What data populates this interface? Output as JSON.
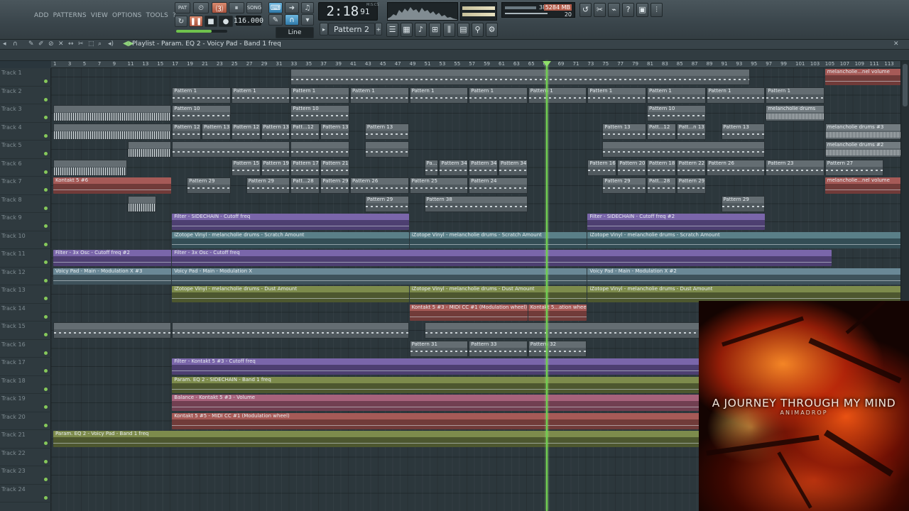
{
  "menu": [
    "ADD",
    "PATTERNS",
    "VIEW",
    "OPTIONS",
    "TOOLS",
    "?"
  ],
  "transport": {
    "pat_label": "PAT",
    "song_label": "SONG",
    "tempo": "116.000",
    "time_main": "2:18",
    "time_sub": "91",
    "time_unit": "M:S:CS",
    "snap": "Line",
    "pattern": "Pattern 2"
  },
  "cpu": {
    "value": "38",
    "memory": "5284 MB",
    "polyphony": "20"
  },
  "playlist": {
    "title": "Playlist - Param. EQ 2 - Voicy Pad - Band 1 freq"
  },
  "ruler": [
    "1",
    "3",
    "5",
    "7",
    "9",
    "11",
    "13",
    "15",
    "17",
    "19",
    "21",
    "23",
    "25",
    "27",
    "29",
    "31",
    "33",
    "35",
    "37",
    "39",
    "41",
    "43",
    "45",
    "47",
    "49",
    "51",
    "53",
    "55",
    "57",
    "59",
    "61",
    "63",
    "65",
    "67",
    "69",
    "71",
    "73",
    "75",
    "77",
    "79",
    "81",
    "83",
    "85",
    "87",
    "89",
    "91",
    "93",
    "95",
    "97",
    "99",
    "101",
    "103",
    "105",
    "107",
    "109",
    "111",
    "113"
  ],
  "tracks": [
    "Track 1",
    "Track 2",
    "Track 3",
    "Track 4",
    "Track 5",
    "Track 6",
    "Track 7",
    "Track 8",
    "Track 9",
    "Track 10",
    "Track 11",
    "Track 12",
    "Track 13",
    "Track 14",
    "Track 15",
    "Track 16",
    "Track 17",
    "Track 18",
    "Track 19",
    "Track 20",
    "Track 21",
    "Track 22",
    "Track 23",
    "Track 24"
  ],
  "clips": [
    {
      "t": 0,
      "s": 33,
      "e": 95,
      "k": "pat",
      "n": ""
    },
    {
      "t": 0,
      "s": 105,
      "e": 117,
      "k": "auto",
      "c": "c-red",
      "n": "melancholie...nel volume"
    },
    {
      "t": 1,
      "s": 17,
      "e": 25,
      "k": "pat",
      "n": "Pattern 1"
    },
    {
      "t": 1,
      "s": 25,
      "e": 33,
      "k": "pat",
      "n": "Pattern 1"
    },
    {
      "t": 1,
      "s": 33,
      "e": 41,
      "k": "pat",
      "n": "Pattern 1"
    },
    {
      "t": 1,
      "s": 41,
      "e": 49,
      "k": "pat",
      "n": "Pattern 1"
    },
    {
      "t": 1,
      "s": 49,
      "e": 57,
      "k": "pat",
      "n": "Pattern 1"
    },
    {
      "t": 1,
      "s": 57,
      "e": 65,
      "k": "pat",
      "n": "Pattern 1"
    },
    {
      "t": 1,
      "s": 65,
      "e": 73,
      "k": "pat",
      "n": "Pattern 1"
    },
    {
      "t": 1,
      "s": 73,
      "e": 81,
      "k": "pat",
      "n": "Pattern 1"
    },
    {
      "t": 1,
      "s": 81,
      "e": 89,
      "k": "pat",
      "n": "Pattern 1"
    },
    {
      "t": 1,
      "s": 89,
      "e": 97,
      "k": "pat",
      "n": "Pattern 1"
    },
    {
      "t": 1,
      "s": 97,
      "e": 105,
      "k": "pat",
      "n": "Pattern 1"
    },
    {
      "t": 2,
      "s": 1,
      "e": 17,
      "k": "pat",
      "n": "",
      "d": 1
    },
    {
      "t": 2,
      "s": 17,
      "e": 25,
      "k": "pat",
      "n": "Pattern 10"
    },
    {
      "t": 2,
      "s": 33,
      "e": 41,
      "k": "pat",
      "n": "Pattern 10"
    },
    {
      "t": 2,
      "s": 81,
      "e": 89,
      "k": "pat",
      "n": "Pattern 10"
    },
    {
      "t": 2,
      "s": 97,
      "e": 105,
      "k": "audio",
      "n": "melancholie drums"
    },
    {
      "t": 3,
      "s": 1,
      "e": 17,
      "k": "pat",
      "n": "",
      "d": 1
    },
    {
      "t": 3,
      "s": 17,
      "e": 21,
      "k": "pat",
      "n": "Pattern 12"
    },
    {
      "t": 3,
      "s": 21,
      "e": 25,
      "k": "pat",
      "n": "Pattern 13"
    },
    {
      "t": 3,
      "s": 25,
      "e": 29,
      "k": "pat",
      "n": "Pattern 12"
    },
    {
      "t": 3,
      "s": 29,
      "e": 33,
      "k": "pat",
      "n": "Pattern 13"
    },
    {
      "t": 3,
      "s": 33,
      "e": 37,
      "k": "pat",
      "n": "Patt...12"
    },
    {
      "t": 3,
      "s": 37,
      "e": 41,
      "k": "pat",
      "n": "Pattern 13"
    },
    {
      "t": 3,
      "s": 43,
      "e": 49,
      "k": "pat",
      "n": "Pattern 13"
    },
    {
      "t": 3,
      "s": 75,
      "e": 81,
      "k": "pat",
      "n": "Pattern 13"
    },
    {
      "t": 3,
      "s": 81,
      "e": 85,
      "k": "pat",
      "n": "Patt...12"
    },
    {
      "t": 3,
      "s": 85,
      "e": 89,
      "k": "pat",
      "n": "Patt...n 13"
    },
    {
      "t": 3,
      "s": 91,
      "e": 97,
      "k": "pat",
      "n": "Pattern 13"
    },
    {
      "t": 3,
      "s": 105,
      "e": 117,
      "k": "audio",
      "n": "melancholie drums #3"
    },
    {
      "t": 4,
      "s": 11,
      "e": 17,
      "k": "pat",
      "n": "",
      "d": 1
    },
    {
      "t": 4,
      "s": 17,
      "e": 33,
      "k": "pat",
      "n": ""
    },
    {
      "t": 4,
      "s": 33,
      "e": 41,
      "k": "pat",
      "n": ""
    },
    {
      "t": 4,
      "s": 43,
      "e": 49,
      "k": "pat",
      "n": ""
    },
    {
      "t": 4,
      "s": 75,
      "e": 97,
      "k": "pat",
      "n": ""
    },
    {
      "t": 4,
      "s": 105,
      "e": 117,
      "k": "audio",
      "n": "melancholie drums #2"
    },
    {
      "t": 5,
      "s": 1,
      "e": 11,
      "k": "pat",
      "n": "",
      "d": 1
    },
    {
      "t": 5,
      "s": 25,
      "e": 29,
      "k": "pat",
      "n": "Pattern 15"
    },
    {
      "t": 5,
      "s": 29,
      "e": 33,
      "k": "pat",
      "n": "Pattern 19"
    },
    {
      "t": 5,
      "s": 33,
      "e": 37,
      "k": "pat",
      "n": "Pattern 17"
    },
    {
      "t": 5,
      "s": 37,
      "e": 41,
      "k": "pat",
      "n": "Pattern 21"
    },
    {
      "t": 5,
      "s": 51,
      "e": 53,
      "k": "pat",
      "n": "Pa...9"
    },
    {
      "t": 5,
      "s": 53,
      "e": 57,
      "k": "pat",
      "n": "Pattern 34"
    },
    {
      "t": 5,
      "s": 57,
      "e": 61,
      "k": "pat",
      "n": "Pattern 34"
    },
    {
      "t": 5,
      "s": 61,
      "e": 65,
      "k": "pat",
      "n": "Pattern 34"
    },
    {
      "t": 5,
      "s": 73,
      "e": 77,
      "k": "pat",
      "n": "Pattern 16"
    },
    {
      "t": 5,
      "s": 77,
      "e": 81,
      "k": "pat",
      "n": "Pattern 20"
    },
    {
      "t": 5,
      "s": 81,
      "e": 85,
      "k": "pat",
      "n": "Pattern 18"
    },
    {
      "t": 5,
      "s": 85,
      "e": 89,
      "k": "pat",
      "n": "Pattern 22"
    },
    {
      "t": 5,
      "s": 89,
      "e": 97,
      "k": "pat",
      "n": "Pattern 26"
    },
    {
      "t": 5,
      "s": 97,
      "e": 105,
      "k": "pat",
      "n": "Pattern 23"
    },
    {
      "t": 5,
      "s": 105,
      "e": 113,
      "k": "pat",
      "n": "Pattern 27"
    },
    {
      "t": 6,
      "s": 1,
      "e": 17,
      "k": "auto",
      "c": "c-red",
      "n": "Kontakt 5 #6"
    },
    {
      "t": 6,
      "s": 19,
      "e": 25,
      "k": "pat",
      "n": "Pattern 29"
    },
    {
      "t": 6,
      "s": 27,
      "e": 33,
      "k": "pat",
      "n": "Pattern 29"
    },
    {
      "t": 6,
      "s": 33,
      "e": 37,
      "k": "pat",
      "n": "Patt...28"
    },
    {
      "t": 6,
      "s": 37,
      "e": 41,
      "k": "pat",
      "n": "Pattern 29"
    },
    {
      "t": 6,
      "s": 41,
      "e": 49,
      "k": "pat",
      "n": "Pattern 26"
    },
    {
      "t": 6,
      "s": 49,
      "e": 57,
      "k": "pat",
      "n": "Pattern 25"
    },
    {
      "t": 6,
      "s": 57,
      "e": 65,
      "k": "pat",
      "n": "Pattern 24"
    },
    {
      "t": 6,
      "s": 75,
      "e": 81,
      "k": "pat",
      "n": "Pattern 29"
    },
    {
      "t": 6,
      "s": 81,
      "e": 85,
      "k": "pat",
      "n": "Patt...28"
    },
    {
      "t": 6,
      "s": 85,
      "e": 89,
      "k": "pat",
      "n": "Pattern 29"
    },
    {
      "t": 6,
      "s": 105,
      "e": 117,
      "k": "auto",
      "c": "c-red",
      "n": "melancholie...nel volume"
    },
    {
      "t": 7,
      "s": 11,
      "e": 15,
      "k": "pat",
      "n": "",
      "d": 1
    },
    {
      "t": 7,
      "s": 43,
      "e": 49,
      "k": "pat",
      "n": "Pattern 29"
    },
    {
      "t": 7,
      "s": 51,
      "e": 65,
      "k": "pat",
      "n": "Pattern 38"
    },
    {
      "t": 7,
      "s": 91,
      "e": 97,
      "k": "pat",
      "n": "Pattern 29"
    },
    {
      "t": 8,
      "s": 17,
      "e": 49,
      "k": "auto",
      "c": "c-purple",
      "n": "Filter - SIDECHAIN - Cutoff freq"
    },
    {
      "t": 8,
      "s": 73,
      "e": 97,
      "k": "auto",
      "c": "c-purple",
      "n": "Filter - SIDECHAIN - Cutoff freq #2"
    },
    {
      "t": 9,
      "s": 17,
      "e": 49,
      "k": "auto",
      "c": "c-teal",
      "n": "iZotope Vinyl - melancholie drums - Scratch Amount"
    },
    {
      "t": 9,
      "s": 49,
      "e": 73,
      "k": "auto",
      "c": "c-teal",
      "n": "iZotope Vinyl - melancholie drums - Scratch Amount"
    },
    {
      "t": 9,
      "s": 73,
      "e": 117,
      "k": "auto",
      "c": "c-teal",
      "n": "iZotope Vinyl - melancholie drums - Scratch Amount"
    },
    {
      "t": 10,
      "s": 1,
      "e": 17,
      "k": "auto",
      "c": "c-purple",
      "n": "Filter - 3x Osc - Cutoff freq #2"
    },
    {
      "t": 10,
      "s": 17,
      "e": 106,
      "k": "auto",
      "c": "c-purple",
      "n": "Filter - 3x Osc - Cutoff freq"
    },
    {
      "t": 11,
      "s": 1,
      "e": 17,
      "k": "auto",
      "c": "c-steel",
      "n": "Voicy Pad - Main - Modulation X #3"
    },
    {
      "t": 11,
      "s": 17,
      "e": 73,
      "k": "auto",
      "c": "c-steel",
      "n": "Voicy Pad - Main - Modulation X"
    },
    {
      "t": 11,
      "s": 73,
      "e": 117,
      "k": "auto",
      "c": "c-steel",
      "n": "Voicy Pad - Main - Modulation X #2"
    },
    {
      "t": 12,
      "s": 17,
      "e": 49,
      "k": "auto",
      "c": "c-olive",
      "n": "iZotope Vinyl - melancholie drums - Dust Amount"
    },
    {
      "t": 12,
      "s": 49,
      "e": 73,
      "k": "auto",
      "c": "c-olive",
      "n": "iZotope Vinyl - melancholie drums - Dust Amount"
    },
    {
      "t": 12,
      "s": 73,
      "e": 117,
      "k": "auto",
      "c": "c-olive",
      "n": "iZotope Vinyl - melancholie drums - Dust Amount"
    },
    {
      "t": 13,
      "s": 49,
      "e": 65,
      "k": "auto",
      "c": "c-red",
      "n": "Kontakt 5 #3 - MIDI CC #1 (Modulation wheel)"
    },
    {
      "t": 13,
      "s": 65,
      "e": 73,
      "k": "auto",
      "c": "c-red",
      "n": "Kontakt 5...ation wheel)"
    },
    {
      "t": 14,
      "s": 1,
      "e": 17,
      "k": "pat",
      "n": ""
    },
    {
      "t": 14,
      "s": 17,
      "e": 49,
      "k": "pat",
      "n": ""
    },
    {
      "t": 14,
      "s": 51,
      "e": 117,
      "k": "pat",
      "n": ""
    },
    {
      "t": 15,
      "s": 49,
      "e": 57,
      "k": "pat",
      "n": "Pattern 31"
    },
    {
      "t": 15,
      "s": 57,
      "e": 65,
      "k": "pat",
      "n": "Pattern 33"
    },
    {
      "t": 15,
      "s": 65,
      "e": 73,
      "k": "pat",
      "n": "Pattern 32"
    },
    {
      "t": 16,
      "s": 17,
      "e": 117,
      "k": "auto",
      "c": "c-purple",
      "n": "Filter - Kontakt 5 #3 - Cutoff freq"
    },
    {
      "t": 17,
      "s": 17,
      "e": 117,
      "k": "auto",
      "c": "c-olive",
      "n": "Param. EQ 2 - SIDECHAIN - Band 1 freq"
    },
    {
      "t": 18,
      "s": 17,
      "e": 117,
      "k": "auto",
      "c": "c-pink",
      "n": "Balance - Kontakt 5 #3 - Volume"
    },
    {
      "t": 19,
      "s": 17,
      "e": 117,
      "k": "auto",
      "c": "c-red",
      "n": "Kontakt 5 #5 - MIDI CC #1 (Modulation wheel)"
    },
    {
      "t": 20,
      "s": 1,
      "e": 117,
      "k": "auto",
      "c": "c-olive",
      "n": "Param. EQ 2 - Voicy Pad - Band 1 freq"
    }
  ],
  "playhead_bar": 67.5,
  "album": {
    "title": "A JOURNEY THROUGH MY MIND",
    "artist": "ANIMADROP"
  }
}
